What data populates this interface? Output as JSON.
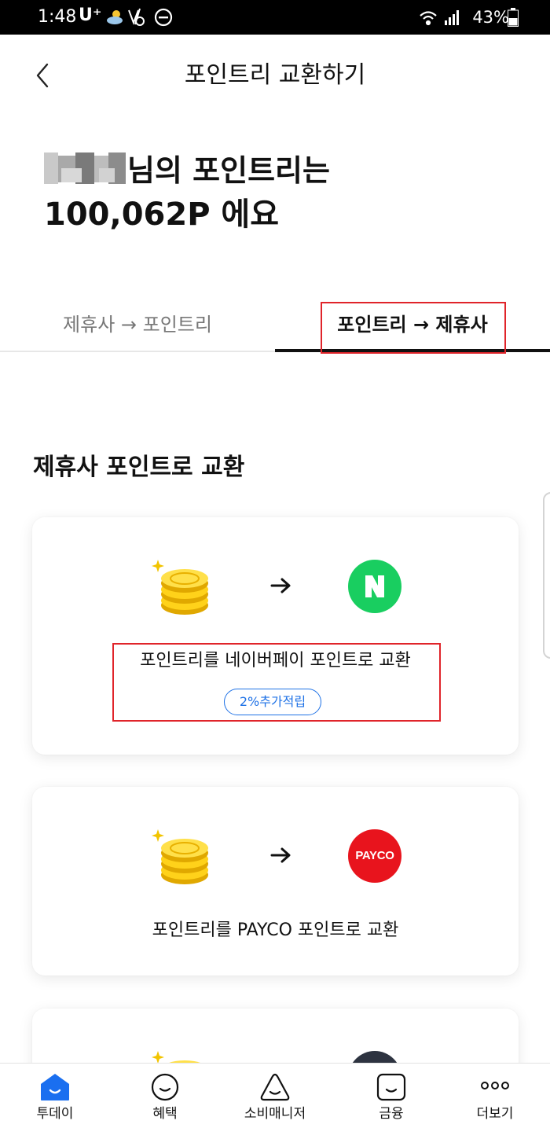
{
  "status_bar": {
    "time": "1:48",
    "carrier": "U⁺",
    "battery": "43%"
  },
  "header": {
    "title": "포인트리 교환하기",
    "back_icon": "chevron-left-icon"
  },
  "greeting": {
    "suffix": "님의 포인트리는",
    "points": "100,062P 에요"
  },
  "tabs": [
    {
      "label": "제휴사 → 포인트리",
      "active": false
    },
    {
      "label": "포인트리 → 제휴사",
      "active": true
    }
  ],
  "section": {
    "title": "제휴사 포인트로 교환"
  },
  "cards": [
    {
      "description": "포인트리를 네이버페이 포인트로 교환",
      "badge": "2%추가적립",
      "partner_logo": "N",
      "partner_color": "#19ce60"
    },
    {
      "description": "포인트리를 PAYCO 포인트로 교환",
      "partner_logo": "PAYCO",
      "partner_color": "#e8141d"
    }
  ],
  "colors": {
    "accent_blue": "#1f72e6",
    "highlight_red": "#e0242a",
    "nav_active": "#1a6ff0"
  },
  "bottom_nav": [
    {
      "label": "투데이",
      "icon": "home-icon",
      "active": true
    },
    {
      "label": "혜택",
      "icon": "smile-circle-icon",
      "active": false
    },
    {
      "label": "소비매니저",
      "icon": "triangle-face-icon",
      "active": false
    },
    {
      "label": "금융",
      "icon": "square-face-icon",
      "active": false
    },
    {
      "label": "더보기",
      "icon": "more-dots-icon",
      "active": false
    }
  ]
}
